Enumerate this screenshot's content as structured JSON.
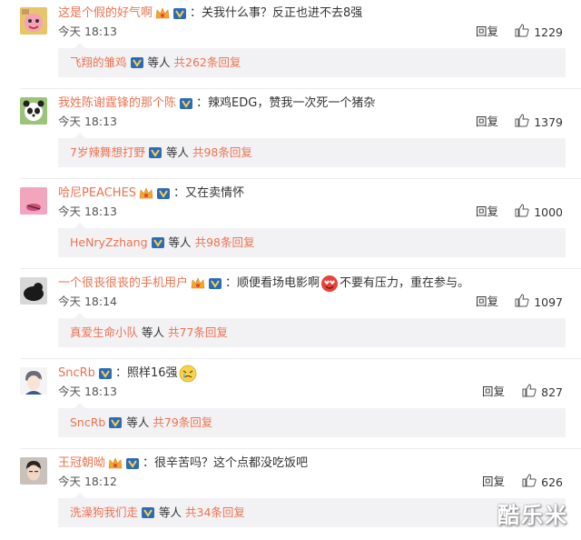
{
  "comments": [
    {
      "username": "这是个假的好气啊",
      "colon": "：",
      "text": "关我什么事？反正也进不去8强",
      "time": "今天 18:13",
      "reply_label": "回复",
      "likes": "1229",
      "avatar_icon": "pink-cartoon-avatar",
      "sub_reply": {
        "name": "飞翔的雏鸡",
        "suffix": "等人",
        "count": "共262条回复"
      }
    },
    {
      "username": "我姓陈谢霆锋的那个陈",
      "colon": "：",
      "text": "辣鸡EDG，赞我一次死一个猪杂",
      "time": "今天 18:13",
      "reply_label": "回复",
      "likes": "1379",
      "avatar_icon": "panda-avatar",
      "sub_reply": {
        "name": "7岁辣舞想打野",
        "suffix": "等人",
        "count": "共98条回复"
      }
    },
    {
      "username": "哈尼PEACHES",
      "colon": "：",
      "text": "又在卖情怀",
      "time": "今天 18:13",
      "reply_label": "回复",
      "likes": "1000",
      "avatar_icon": "pink-avatar",
      "sub_reply": {
        "name": "HeNryZzhang",
        "suffix": "等人",
        "count": "共98条回复"
      }
    },
    {
      "username": "一个很丧很丧的手机用户",
      "colon": "：",
      "text_before": "顺便看场电影啊",
      "text_after": "不要有压力，重在参与。",
      "time": "今天 18:14",
      "reply_label": "回复",
      "likes": "1097",
      "avatar_icon": "dark-cat-avatar",
      "sub_reply": {
        "name": "真爱生命小队",
        "suffix": "等人",
        "count": "共77条回复"
      }
    },
    {
      "username": "SncRb",
      "colon": "：",
      "text": "照样16强",
      "time": "今天 18:13",
      "reply_label": "回复",
      "likes": "827",
      "avatar_icon": "anime-boy-avatar",
      "sub_reply": {
        "name": "SncRb",
        "suffix": "等人",
        "count": "共79条回复"
      }
    },
    {
      "username": "王冠朝呦",
      "colon": "：",
      "text": "很辛苦吗？这个点都没吃饭吧",
      "time": "今天 18:12",
      "reply_label": "回复",
      "likes": "626",
      "avatar_icon": "face-photo-avatar",
      "sub_reply": {
        "name": "洗澡狗我们走",
        "suffix": "等人",
        "count": "共34条回复"
      }
    }
  ],
  "watermark": "酷乐米",
  "colors": {
    "username": "#eb7350",
    "subbox_bg": "#f2f2f5",
    "divider": "#ececec"
  }
}
